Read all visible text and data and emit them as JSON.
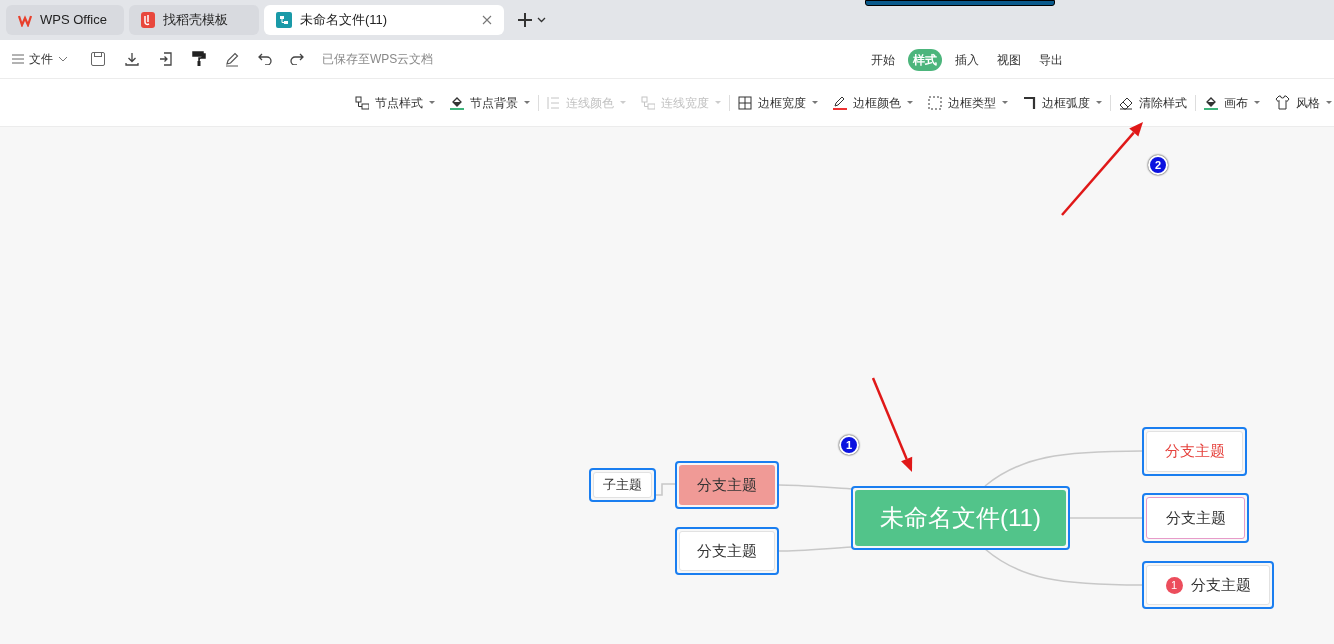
{
  "tabs": [
    {
      "label": "WPS Office",
      "kind": "wps",
      "selected": false
    },
    {
      "label": "找稻壳模板",
      "kind": "template",
      "selected": false
    },
    {
      "label": "未命名文件(11)",
      "kind": "doc",
      "selected": true
    }
  ],
  "toolbar": {
    "file_menu": "文件",
    "save_status": "已保存至WPS云文档"
  },
  "menu_tabs": [
    {
      "label": "开始",
      "selected": false
    },
    {
      "label": "样式",
      "selected": true
    },
    {
      "label": "插入",
      "selected": false
    },
    {
      "label": "视图",
      "selected": false
    },
    {
      "label": "导出",
      "selected": false
    }
  ],
  "style_toolbar": [
    [
      {
        "label": "节点样式",
        "disabled": false,
        "dropdown": true
      },
      {
        "label": "节点背景",
        "disabled": false,
        "dropdown": true
      }
    ],
    [
      {
        "label": "连线颜色",
        "disabled": true,
        "dropdown": true
      },
      {
        "label": "连线宽度",
        "disabled": true,
        "dropdown": true
      }
    ],
    [
      {
        "label": "边框宽度",
        "disabled": false,
        "dropdown": true
      },
      {
        "label": "边框颜色",
        "disabled": false,
        "dropdown": true
      },
      {
        "label": "边框类型",
        "disabled": false,
        "dropdown": true
      },
      {
        "label": "边框弧度",
        "disabled": false,
        "dropdown": true
      }
    ],
    [
      {
        "label": "清除样式",
        "disabled": false,
        "dropdown": false
      }
    ],
    [
      {
        "label": "画布",
        "disabled": false,
        "dropdown": true
      },
      {
        "label": "风格",
        "disabled": false,
        "dropdown": true
      }
    ]
  ],
  "mind_map": {
    "root": {
      "text": "未命名文件(11)",
      "selected": true
    },
    "left": [
      {
        "text": "分支主题",
        "kind": "highlighted",
        "selected": true,
        "children": [
          {
            "text": "子主题",
            "kind": "plain",
            "selected": true
          }
        ]
      },
      {
        "text": "分支主题",
        "kind": "plain",
        "selected": true
      }
    ],
    "right": [
      {
        "text": "分支主题",
        "kind": "red-text",
        "selected": true
      },
      {
        "text": "分支主题",
        "kind": "pink-outline",
        "selected": true
      },
      {
        "text": "分支主题",
        "kind": "plain",
        "selected": true,
        "priority": "1"
      }
    ]
  },
  "annotations": [
    {
      "label": "1"
    },
    {
      "label": "2"
    }
  ]
}
